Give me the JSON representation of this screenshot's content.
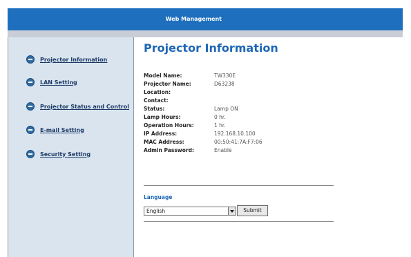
{
  "header": {
    "title": "Web Management"
  },
  "sidebar": {
    "items": [
      {
        "label": "Projector Information"
      },
      {
        "label": "LAN Setting"
      },
      {
        "label": "Projector Status and Control"
      },
      {
        "label": "E-mail Setting"
      },
      {
        "label": "Security Setting"
      }
    ]
  },
  "main": {
    "title": "Projector Information",
    "info": [
      {
        "label": "Model Name:",
        "value": "TW330E"
      },
      {
        "label": "Projector Name:",
        "value": "D63238"
      },
      {
        "label": "Location:",
        "value": ""
      },
      {
        "label": "Contact:",
        "value": ""
      },
      {
        "label": "Status:",
        "value": "Lamp ON"
      },
      {
        "label": "Lamp Hours:",
        "value": "0 hr."
      },
      {
        "label": "Operation Hours:",
        "value": "1 hr."
      },
      {
        "label": "IP Address:",
        "value": "192.168.10.100"
      },
      {
        "label": "MAC Address:",
        "value": "00:50:41:7A:F7:06"
      },
      {
        "label": "Admin Password:",
        "value": "Enable"
      }
    ],
    "language": {
      "label": "Language",
      "selected": "English",
      "submit_label": "Submit"
    }
  },
  "colors": {
    "header_bg": "#1f6fbf",
    "sidebar_bg": "#d9e4ef",
    "title": "#1e67b5"
  }
}
